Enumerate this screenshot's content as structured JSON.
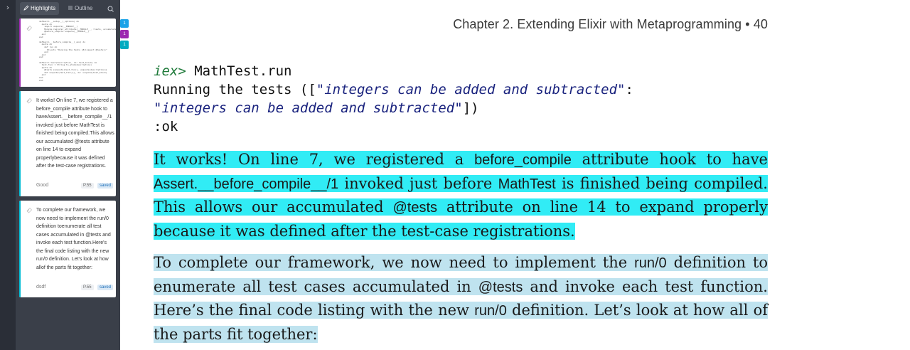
{
  "sidebar": {
    "tabs": [
      {
        "label": "Highlights",
        "icon": "pencil-icon"
      },
      {
        "label": "Outline",
        "icon": "list-icon"
      }
    ],
    "cards": [
      {
        "accent": "#9c27b0",
        "code_preview": "defmacro __setup__(_options) do\n  quote do\n    import unquote(__MODULE__)\n    Module.register_attribute(__MODULE__, :tests, accumulate: true)\n    @before_compile unquote(__MODULE__)\n  end\nend\n\ndefmacro __before_compile__(_env) do\n  quote do\n    def run do\n      IO.puts \"Running the tests (#{inspect @tests})\"\n    end\n  end\nend\n\ndefmacro test(description, do: test_block) do\n  test_func = String.to_atom(description)\n  quote do\n    @tests {unquote(test_func), unquote(description)}\n    def unquote(test_func)(), do: unquote(test_block)\n  end\nend\nend"
      },
      {
        "accent": "#00bcd4",
        "text": "It works! On line 7, we registered a before_compile attribute hook to haveAssert.__before_compile__/1 invoked just before MathTest is finished being compiled.This allows our accumulated @tests attribute on line 14 to expand properlybecause it was defined after the test-case registrations.",
        "note": "Good",
        "page": "P.55",
        "badge": "saved"
      },
      {
        "accent": "#00bcd4",
        "text": "To complete our framework, we now need to implement the run/0 definition toenumerate all test cases accumulated in @tests and invoke each test function.Here's the final code listing with the new run/0 definition. Let's look at how allof the parts fit together:",
        "note": "dsdf",
        "page": "P.55",
        "badge": "saved"
      }
    ]
  },
  "markers": [
    {
      "label": "1",
      "color": "#1aa3e8"
    },
    {
      "label": "1",
      "color": "#9c27b0"
    },
    {
      "label": "1",
      "color": "#00acc1"
    }
  ],
  "page": {
    "header": "Chapter 2. Extending Elixir with Metaprogramming • 40",
    "code": {
      "prompt": "iex>",
      "command": " MathTest.run",
      "line2_prefix": "Running the tests ([",
      "string1": "\"integers can be added and subtracted\"",
      "line2_suffix": ":",
      "string2": "\"integers can be added and subtracted\"",
      "line3_suffix": "])",
      "result": ":ok"
    },
    "para1": {
      "t1": "It works! On line 7, we registered a ",
      "c1": "before_compile",
      "t2": " attribute hook to have ",
      "c2": "Assert.__before_compile__/1",
      "t3": " invoked just before ",
      "c3": "MathTest",
      "t4": " is finished being compiled. This allows our accumulated ",
      "c4": "@tests",
      "t5": " attribute on line 14 to expand properly because it was defined after the test-case registrations."
    },
    "para2": {
      "t1": "To complete our framework, we now need to implement the ",
      "c1": "run/0",
      "t2": " definition to enumerate all test cases accumulated in ",
      "c2": "@tests",
      "t3": " and invoke each test function. Here’s the final code listing with the new ",
      "c3": "run/0",
      "t4": " definition. Let’s look at how all of the parts fit together:"
    }
  }
}
